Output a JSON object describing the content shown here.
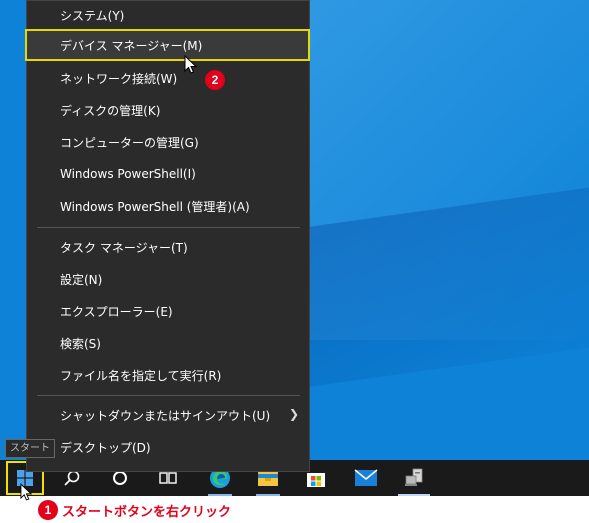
{
  "menu": {
    "items": [
      {
        "label": "システム(Y)"
      },
      {
        "label": "デバイス マネージャー(M)"
      },
      {
        "label": "ネットワーク接続(W)"
      },
      {
        "label": "ディスクの管理(K)"
      },
      {
        "label": "コンピューターの管理(G)"
      },
      {
        "label": "Windows PowerShell(I)"
      },
      {
        "label": "Windows PowerShell (管理者)(A)"
      },
      {
        "label": "タスク マネージャー(T)"
      },
      {
        "label": "設定(N)"
      },
      {
        "label": "エクスプローラー(E)"
      },
      {
        "label": "検索(S)"
      },
      {
        "label": "ファイル名を指定して実行(R)"
      },
      {
        "label": "シャットダウンまたはサインアウト(U)"
      },
      {
        "label": "デスクトップ(D)"
      }
    ],
    "highlighted": "デバイス マネージャー(M)"
  },
  "tooltip": {
    "text": "スタート"
  },
  "annotations": {
    "step1_number": "1",
    "step1_text": "スタートボタンを右クリック",
    "step2_number": "2",
    "accent_color": "#e2001a",
    "highlight_color": "#e6d800"
  },
  "taskbar": {
    "icons": [
      "windows-start-icon",
      "search-icon",
      "cortana-icon",
      "task-view-icon",
      "edge-icon",
      "file-explorer-icon",
      "store-icon",
      "mail-icon",
      "device-manager-icon"
    ]
  }
}
